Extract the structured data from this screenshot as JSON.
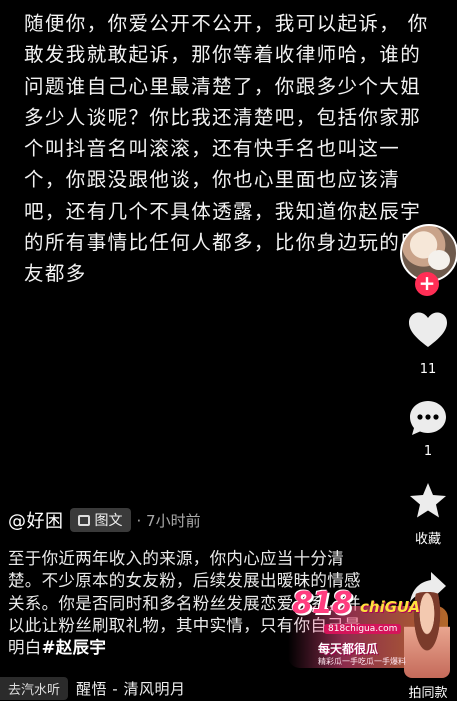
{
  "post": {
    "main_text": "随便你，你爱公开不公开，我可以起诉， 你\n敢发我就敢起诉，那你等着收律师哈，谁的\n问题谁自己心里最清楚了，你跟多少个大姐\n多少人谈呢？你比我还清楚吧，包括你家那\n个叫抖音名叫滚滚，还有快手名也叫这一\n个，你跟没跟他谈，你也心里面也应该清\n吧，还有几个不具体透露，我知道你赵辰宇\n的所有事情比任何人都多，比你身边玩的朋\n友都多"
  },
  "rail": {
    "like_count": "11",
    "comment_count": "1",
    "favorite_label": "收藏",
    "share_label": "拍同款"
  },
  "author": {
    "name": "@好困",
    "badge": "图文",
    "time": "· 7小时前"
  },
  "description": {
    "text": "至于你近两年收入的来源，你内心应当十分清楚。不少原本的女友粉，后续发展出暧昧的情感关系。你是否同时和多名粉丝发展恋爱关系，并以此让粉丝刷取礼物，其中实情，只有你自己最明白",
    "tag": "#赵辰宇"
  },
  "bottom": {
    "source": "去汽水听",
    "music": "醒悟 - 清风明月"
  },
  "watermark": {
    "logo": "818",
    "chigua": "chiGUA",
    "url": "818chigua.com",
    "slogan": "每天都很瓜",
    "sub": "精彩瓜一手吃瓜一手爆料"
  },
  "colors": {
    "background": "#000000",
    "follow": "#ff2e55",
    "badge_bg": "#3a3a3a"
  }
}
